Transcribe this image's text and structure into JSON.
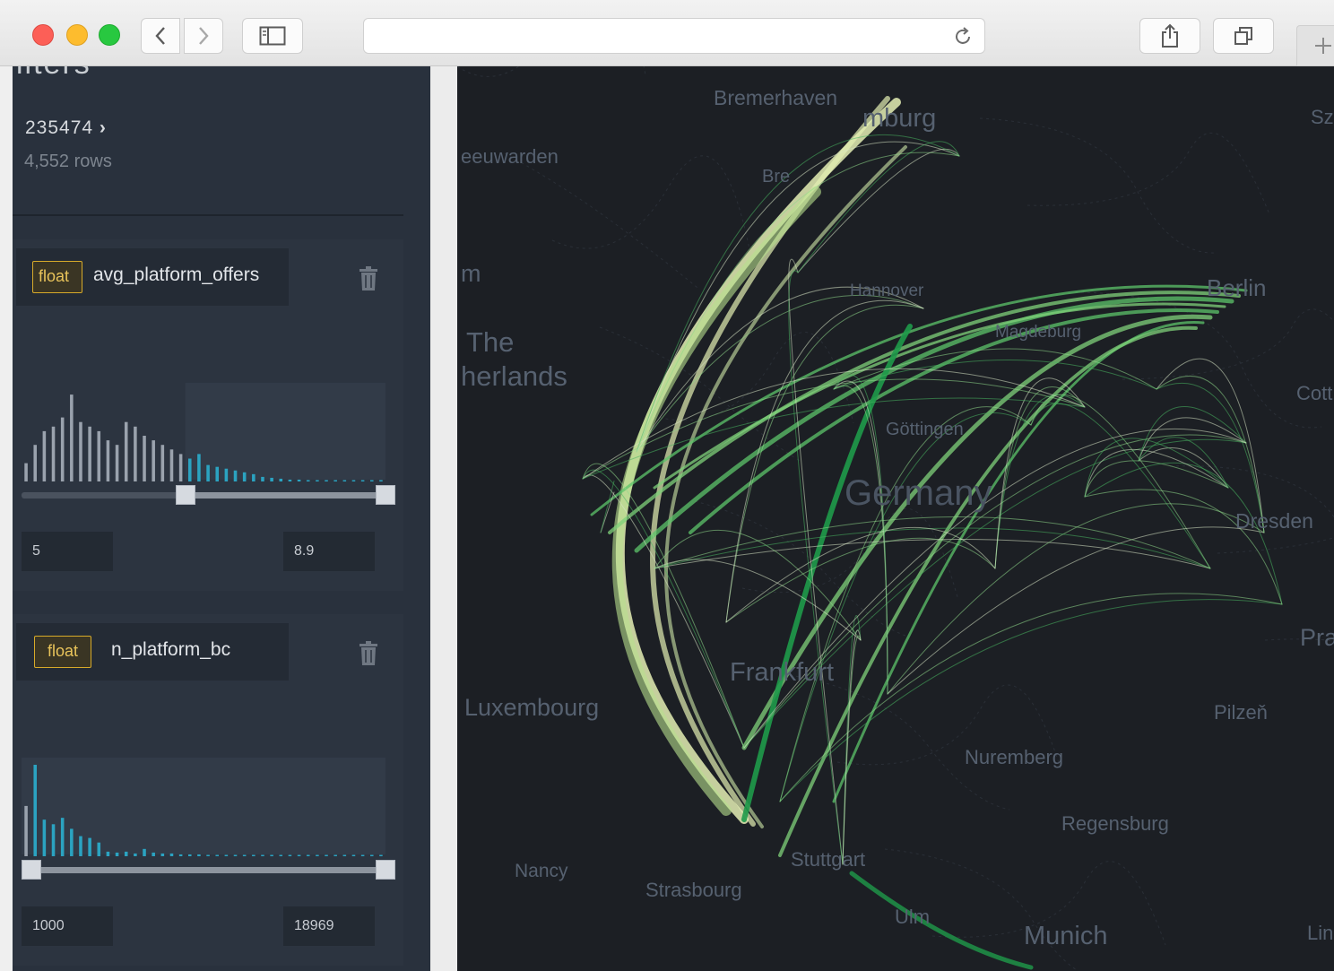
{
  "sidebar": {
    "title_fragment": "ilters",
    "dataset": {
      "id": "235474",
      "rows": "4,552 rows"
    },
    "filters": [
      {
        "type": "float",
        "name": "avg_platform_offers",
        "min_value": "5",
        "max_value": "8.9",
        "range_fraction": [
          0.45,
          1.0
        ],
        "histogram": [
          0.2,
          0.4,
          0.55,
          0.6,
          0.7,
          0.95,
          0.65,
          0.6,
          0.55,
          0.45,
          0.4,
          0.65,
          0.6,
          0.5,
          0.45,
          0.4,
          0.35,
          0.3,
          0.25,
          0.3,
          0.18,
          0.16,
          0.14,
          0.12,
          0.1,
          0.08,
          0.05,
          0.04,
          0.03,
          0.02,
          0.02,
          0.015,
          0.01,
          0.01,
          0.01,
          0.01,
          0.01,
          0.01,
          0.01,
          0.01
        ]
      },
      {
        "type": "float",
        "name": "n_platform_bc",
        "min_value": "1000",
        "max_value": "18969",
        "range_fraction": [
          0.0,
          1.0
        ],
        "histogram": [
          0.55,
          1.0,
          0.4,
          0.35,
          0.42,
          0.3,
          0.22,
          0.2,
          0.15,
          0.05,
          0.04,
          0.05,
          0.03,
          0.08,
          0.04,
          0.03,
          0.03,
          0.02,
          0.02,
          0.02,
          0.015,
          0.015,
          0.015,
          0.015,
          0.01,
          0.01,
          0.01,
          0.01,
          0.01,
          0.01,
          0.01,
          0.015,
          0.01,
          0.01,
          0.01,
          0.01,
          0.01,
          0.01,
          0.01,
          0.01
        ]
      }
    ]
  },
  "map": {
    "labels": [
      "Bremerhaven",
      "mburg",
      "Sz",
      "eeuwarden",
      "Bre",
      "m",
      "Hannover",
      "Berlin",
      "The",
      "herlands",
      "Magdeburg",
      "Cott",
      "Göttingen",
      "Germany",
      "Dresden",
      "Pra",
      "Frankfurt",
      "Luxembourg",
      "Pilzeň",
      "Nuremberg",
      "Regensburg",
      "Nancy",
      "Strasbourg",
      "Stuttgart",
      "Ulm",
      "Munich",
      "Lin"
    ],
    "colors": {
      "background": "#1c1f24",
      "arc_light": "#e4efb4",
      "arc_mid": "#7fd27a",
      "arc_dark": "#1f9a4a"
    }
  },
  "colors": {
    "sidebar": "#29313d",
    "badge": "#d7aa2a",
    "hist_active": "#2ba3c1",
    "hist_inactive": "#9aa2ad"
  }
}
